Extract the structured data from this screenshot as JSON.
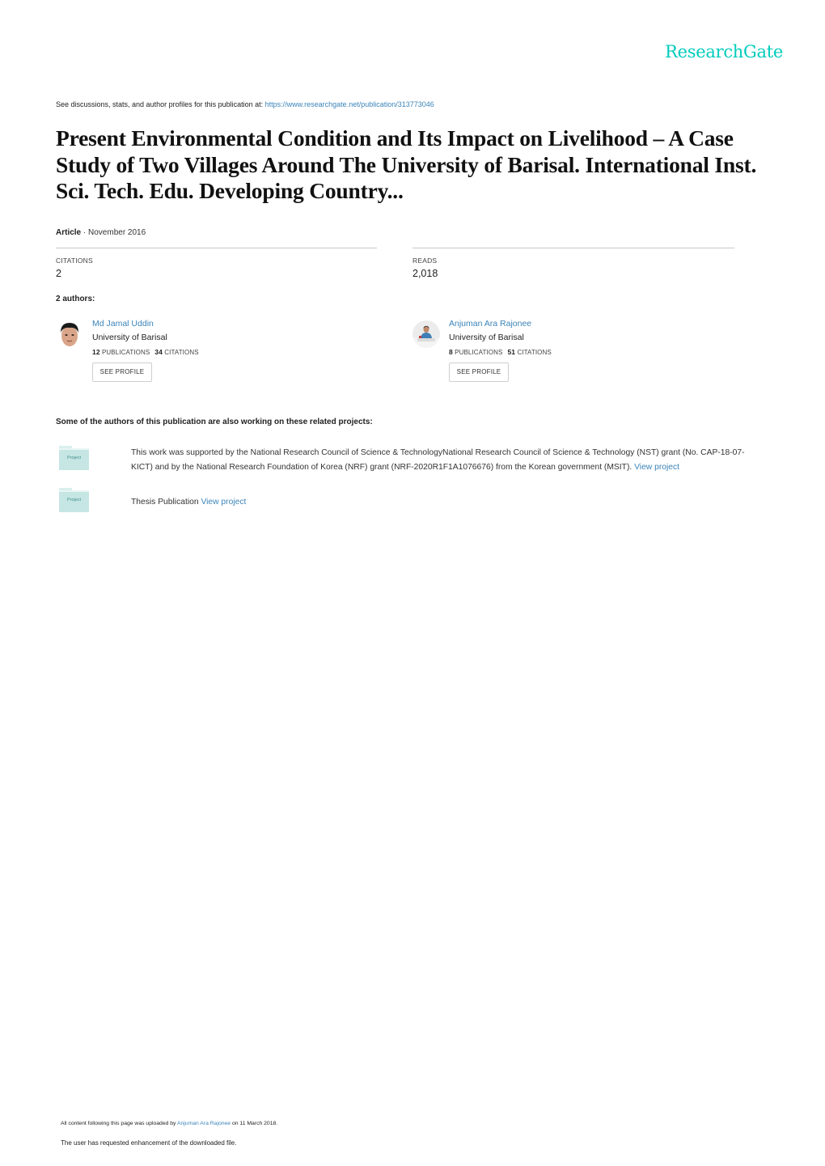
{
  "brand": {
    "logo_text": "ResearchGate",
    "accent_color": "#00ccbb",
    "link_color": "#3b84b9"
  },
  "header": {
    "see_discussions_prefix": "See discussions, stats, and author profiles for this publication at: ",
    "publication_url": "https://www.researchgate.net/publication/313773046"
  },
  "publication": {
    "title": "Present Environmental Condition and Its Impact on Livelihood – A Case Study of Two Villages Around The University of Barisal. International Inst. Sci. Tech. Edu. Developing Country...",
    "type": "Article",
    "separator": " · ",
    "date": "November 2016"
  },
  "stats": {
    "citations_label": "CITATIONS",
    "citations_value": "2",
    "reads_label": "READS",
    "reads_value": "2,018"
  },
  "authors_heading": "2 authors:",
  "authors": [
    {
      "name": "Md Jamal Uddin",
      "institution": "University of Barisal",
      "publications_count": "12",
      "publications_label": "PUBLICATIONS",
      "citations_count": "34",
      "citations_label": "CITATIONS",
      "button_label": "SEE PROFILE"
    },
    {
      "name": "Anjuman Ara Rajonee",
      "institution": "University of Barisal",
      "publications_count": "8",
      "publications_label": "PUBLICATIONS",
      "citations_count": "51",
      "citations_label": "CITATIONS",
      "button_label": "SEE PROFILE"
    }
  ],
  "related_projects": {
    "heading": "Some of the authors of this publication are also working on these related projects:",
    "icon_label": "Project",
    "items": [
      {
        "text": "This work was supported by the National Research Council of Science & TechnologyNational Research Council of Science & Technology (NST) grant (No. CAP-18-07-KICT) and by the National Research Foundation of Korea (NRF) grant (NRF-2020R1F1A1076676) from the Korean government (MSIT). ",
        "link": "View project"
      },
      {
        "text": "Thesis Publication ",
        "link": "View project"
      }
    ]
  },
  "footer": {
    "uploaded_prefix": "All content following this page was uploaded by ",
    "uploader": "Anjuman Ara Rajonee",
    "uploaded_suffix": " on 11 March 2018.",
    "enhancement_note": "The user has requested enhancement of the downloaded file."
  }
}
